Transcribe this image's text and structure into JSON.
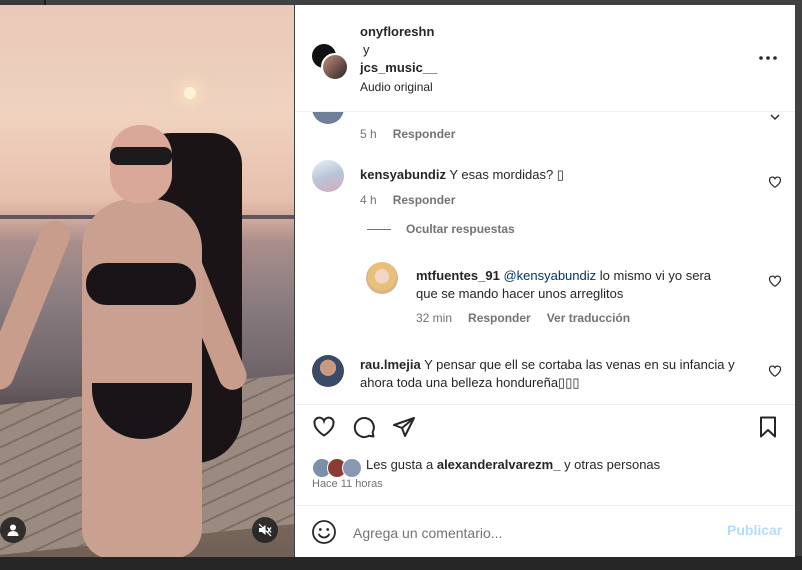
{
  "header": {
    "user1": "onyfloreshn",
    "connector": "y",
    "user2": "jcs_music__",
    "audio": "Audio original",
    "more_icon": "more-horizontal-icon"
  },
  "comments": [
    {
      "time": "5 h",
      "reply": "Responder"
    },
    {
      "username": "kensyabundiz",
      "text": "Y esas mordidas? ▯",
      "time": "4 h",
      "reply": "Responder"
    }
  ],
  "hide_replies": "Ocultar respuestas",
  "reply": {
    "username": "mtfuentes_91",
    "mention": "@kensyabundiz",
    "text_line1": "lo mismo vi yo sera",
    "text_line2": "que se mando hacer unos arreglitos",
    "time": "32 min",
    "reply": "Responder",
    "translate": "Ver traducción"
  },
  "comment3": {
    "username": "rau.lmejia",
    "text_line1": "Y pensar que ell se cortaba las venas en su infancia y",
    "text_line2": "ahora toda una belleza hondureña▯▯▯"
  },
  "likes": {
    "prefix": "Les gusta a",
    "user": "alexanderalvarezm_",
    "suffix": "y otras personas"
  },
  "time_ago": "Hace 11 horas",
  "composer": {
    "placeholder": "Agrega un comentario...",
    "publish": "Publicar"
  },
  "colors": {
    "link": "#00376b",
    "publish_disabled": "#b3dbff",
    "meta": "#737373"
  }
}
